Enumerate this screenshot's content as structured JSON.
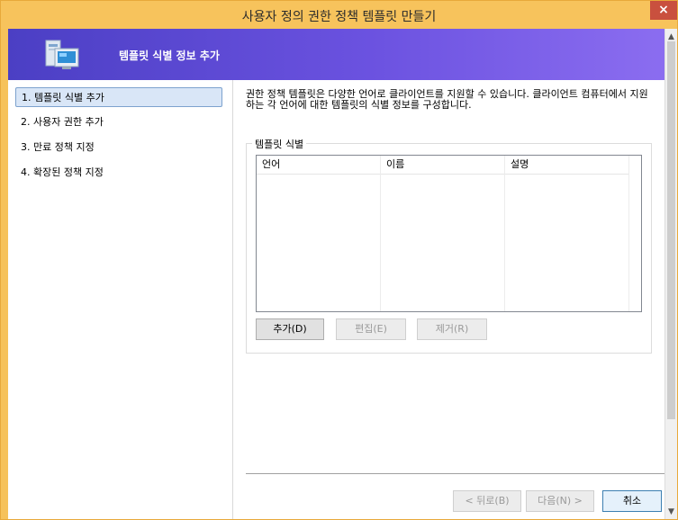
{
  "window": {
    "title": "사용자 정의 권한 정책 템플릿 만들기",
    "close_glyph": "×"
  },
  "header": {
    "title": "템플릿 식별 정보 추가",
    "icon": "computer-monitor-icon"
  },
  "steps": [
    {
      "label": "1. 템플릿 식별 추가"
    },
    {
      "label": "2. 사용자 권한 추가"
    },
    {
      "label": "3. 만료 정책 지정"
    },
    {
      "label": "4. 확장된 정책 지정"
    }
  ],
  "content": {
    "description": "권한 정책 템플릿은 다양한 언어로 클라이언트를 지원할 수 있습니다. 클라이언트 컴퓨터에서 지원하는 각 언어에 대한 템플릿의 식별 정보를 구성합니다.",
    "group_label": "템플릿 식별",
    "columns": [
      "언어",
      "이름",
      "설명"
    ],
    "buttons": {
      "add": "추가(D)",
      "edit": "편집(E)",
      "remove": "제거(R)"
    }
  },
  "footer": {
    "back": "< 뒤로(B)",
    "next": "다음(N) >",
    "cancel": "취소"
  },
  "scrollbar": {
    "up": "▲",
    "down": "▼"
  }
}
